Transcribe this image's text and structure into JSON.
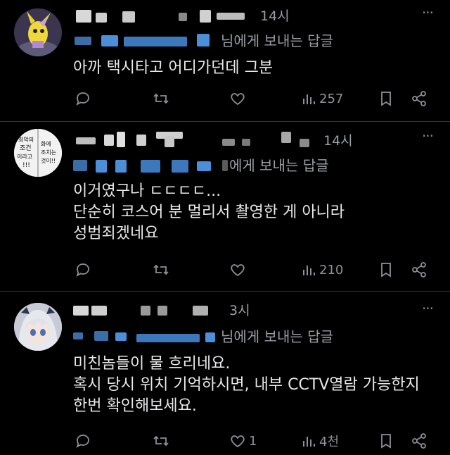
{
  "colors": {
    "background": "#000000",
    "text": "#e7e9ea",
    "muted": "#8b9196",
    "divider": "#2f3336",
    "redaction_blue": "#4a8fd8"
  },
  "replies": [
    {
      "time": "14시",
      "replying_to_suffix": "님에게 보내는 답글",
      "text": "아까 택시타고 어디가던데 그분",
      "avatar_icon": "yellow-pokemon-avatar",
      "actions": {
        "reply_count": "",
        "retweet_count": "",
        "like_count": "",
        "views": "257"
      }
    },
    {
      "time": "14시",
      "replying_to_suffix": "에게 보내는 답글",
      "text": "이거였구나 ㄷㄷㄷㄷ...\n단순히 코스어 분 멀리서 촬영한 게 아니라\n성범죄겠네요",
      "avatar_icon": "manga-panel-avatar",
      "avatar_text": [
        "최악의",
        "조건",
        "이라고",
        "!!!",
        "화에",
        "조치는",
        "것이!!"
      ],
      "actions": {
        "reply_count": "",
        "retweet_count": "",
        "like_count": "",
        "views": "210"
      }
    },
    {
      "time": "3시",
      "replying_to_suffix": "님에게 보내는 답글",
      "text": "미친놈들이 물 흐리네요.\n혹시 당시 위치 기억하시면, 내부 CCTV열람 가능한지\n한번 확인해보세요.",
      "avatar_icon": "anime-girl-avatar",
      "actions": {
        "reply_count": "",
        "retweet_count": "",
        "like_count": "1",
        "views": "4천"
      }
    }
  ]
}
